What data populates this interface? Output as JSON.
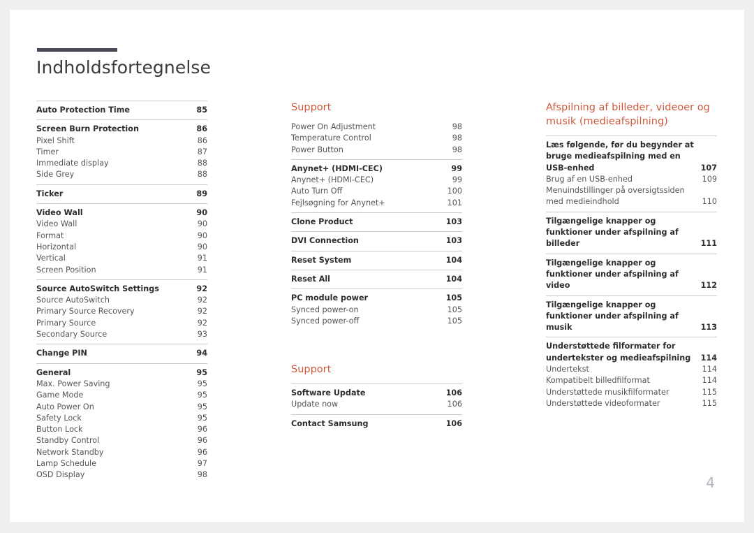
{
  "document": {
    "title": "Indholdsfortegnelse",
    "folio": "4",
    "accent_color": "#cf5a3e",
    "rule_color": "#4a4655"
  },
  "columns": [
    {
      "name": "column-1",
      "groups": [
        {
          "entries": [
            {
              "label": "Auto Protection Time",
              "page": "85",
              "level": "head"
            }
          ]
        },
        {
          "entries": [
            {
              "label": "Screen Burn Protection",
              "page": "86",
              "level": "head"
            },
            {
              "label": "Pixel Shift",
              "page": "86",
              "level": "sub"
            },
            {
              "label": "Timer",
              "page": "87",
              "level": "sub"
            },
            {
              "label": "Immediate display",
              "page": "88",
              "level": "sub"
            },
            {
              "label": "Side Grey",
              "page": "88",
              "level": "sub"
            }
          ]
        },
        {
          "entries": [
            {
              "label": "Ticker",
              "page": "89",
              "level": "head"
            }
          ]
        },
        {
          "entries": [
            {
              "label": "Video Wall",
              "page": "90",
              "level": "head"
            },
            {
              "label": "Video Wall",
              "page": "90",
              "level": "sub"
            },
            {
              "label": "Format",
              "page": "90",
              "level": "sub"
            },
            {
              "label": "Horizontal",
              "page": "90",
              "level": "sub"
            },
            {
              "label": "Vertical",
              "page": "91",
              "level": "sub"
            },
            {
              "label": "Screen Position",
              "page": "91",
              "level": "sub"
            }
          ]
        },
        {
          "entries": [
            {
              "label": "Source AutoSwitch Settings",
              "page": "92",
              "level": "head"
            },
            {
              "label": "Source AutoSwitch",
              "page": "92",
              "level": "sub"
            },
            {
              "label": "Primary Source Recovery",
              "page": "92",
              "level": "sub"
            },
            {
              "label": "Primary Source",
              "page": "92",
              "level": "sub"
            },
            {
              "label": "Secondary Source",
              "page": "93",
              "level": "sub"
            }
          ]
        },
        {
          "entries": [
            {
              "label": "Change PIN",
              "page": "94",
              "level": "head"
            }
          ]
        },
        {
          "entries": [
            {
              "label": "General",
              "page": "95",
              "level": "head"
            },
            {
              "label": "Max. Power Saving",
              "page": "95",
              "level": "sub"
            },
            {
              "label": "Game Mode",
              "page": "95",
              "level": "sub"
            },
            {
              "label": "Auto Power On",
              "page": "95",
              "level": "sub"
            },
            {
              "label": "Safety Lock",
              "page": "95",
              "level": "sub"
            },
            {
              "label": "Button Lock",
              "page": "96",
              "level": "sub"
            },
            {
              "label": "Standby Control",
              "page": "96",
              "level": "sub"
            },
            {
              "label": "Network Standby",
              "page": "96",
              "level": "sub"
            },
            {
              "label": "Lamp Schedule",
              "page": "97",
              "level": "sub"
            },
            {
              "label": "OSD Display",
              "page": "98",
              "level": "sub"
            }
          ]
        }
      ]
    },
    {
      "name": "column-2",
      "groups": [
        {
          "rule": false,
          "entries": [
            {
              "label": "Power On Adjustment",
              "page": "98",
              "level": "sub"
            },
            {
              "label": "Temperature Control",
              "page": "98",
              "level": "sub"
            },
            {
              "label": "Power Button",
              "page": "98",
              "level": "sub"
            }
          ]
        },
        {
          "entries": [
            {
              "label": "Anynet+ (HDMI-CEC)",
              "page": "99",
              "level": "head"
            },
            {
              "label": "Anynet+ (HDMI-CEC)",
              "page": "99",
              "level": "sub"
            },
            {
              "label": "Auto Turn Off",
              "page": "100",
              "level": "sub"
            },
            {
              "label": "Fejlsøgning for Anynet+",
              "page": "101",
              "level": "sub"
            }
          ]
        },
        {
          "entries": [
            {
              "label": "Clone Product",
              "page": "103",
              "level": "head"
            }
          ]
        },
        {
          "entries": [
            {
              "label": "DVI Connection",
              "page": "103",
              "level": "head"
            }
          ]
        },
        {
          "entries": [
            {
              "label": "Reset System",
              "page": "104",
              "level": "head"
            }
          ]
        },
        {
          "entries": [
            {
              "label": "Reset All",
              "page": "104",
              "level": "head"
            }
          ]
        },
        {
          "entries": [
            {
              "label": "PC module power",
              "page": "105",
              "level": "head"
            },
            {
              "label": "Synced power-on",
              "page": "105",
              "level": "sub"
            },
            {
              "label": "Synced power-off",
              "page": "105",
              "level": "sub"
            }
          ]
        }
      ],
      "heading": "Support",
      "heading_groups": [
        {
          "entries": [
            {
              "label": "Software Update",
              "page": "106",
              "level": "head"
            },
            {
              "label": "Update now",
              "page": "106",
              "level": "sub"
            }
          ]
        },
        {
          "entries": [
            {
              "label": "Contact Samsung",
              "page": "106",
              "level": "head"
            }
          ]
        }
      ]
    },
    {
      "name": "column-3",
      "heading": "Afspilning af billeder, videoer og musik (medieafspilning)",
      "groups": [
        {
          "entries": [
            {
              "label": "Læs følgende, før du begynder at bruge medieafspilning med en USB-enhed",
              "page": "107",
              "level": "head",
              "multiline": true
            },
            {
              "label": "Brug af en USB-enhed",
              "page": "109",
              "level": "sub"
            },
            {
              "label": "Menuindstillinger på oversigtssiden med medieindhold",
              "page": "110",
              "level": "sub",
              "multiline": true
            }
          ]
        },
        {
          "entries": [
            {
              "label": "Tilgængelige knapper og funktioner under afspilning af billeder",
              "page": "111",
              "level": "head",
              "multiline": true
            }
          ]
        },
        {
          "entries": [
            {
              "label": "Tilgængelige knapper og funktioner under afspilning af video",
              "page": "112",
              "level": "head",
              "multiline": true
            }
          ]
        },
        {
          "entries": [
            {
              "label": "Tilgængelige knapper og funktioner under afspilning af musik",
              "page": "113",
              "level": "head",
              "multiline": true
            }
          ]
        },
        {
          "entries": [
            {
              "label": "Understøttede filformater for undertekster og medieafspilning",
              "page": "114",
              "level": "head",
              "multiline": true
            },
            {
              "label": "Undertekst",
              "page": "114",
              "level": "sub"
            },
            {
              "label": "Kompatibelt billedfilformat",
              "page": "114",
              "level": "sub"
            },
            {
              "label": "Understøttede musikfilformater",
              "page": "115",
              "level": "sub"
            },
            {
              "label": "Understøttede videoformater",
              "page": "115",
              "level": "sub"
            }
          ]
        }
      ]
    }
  ]
}
